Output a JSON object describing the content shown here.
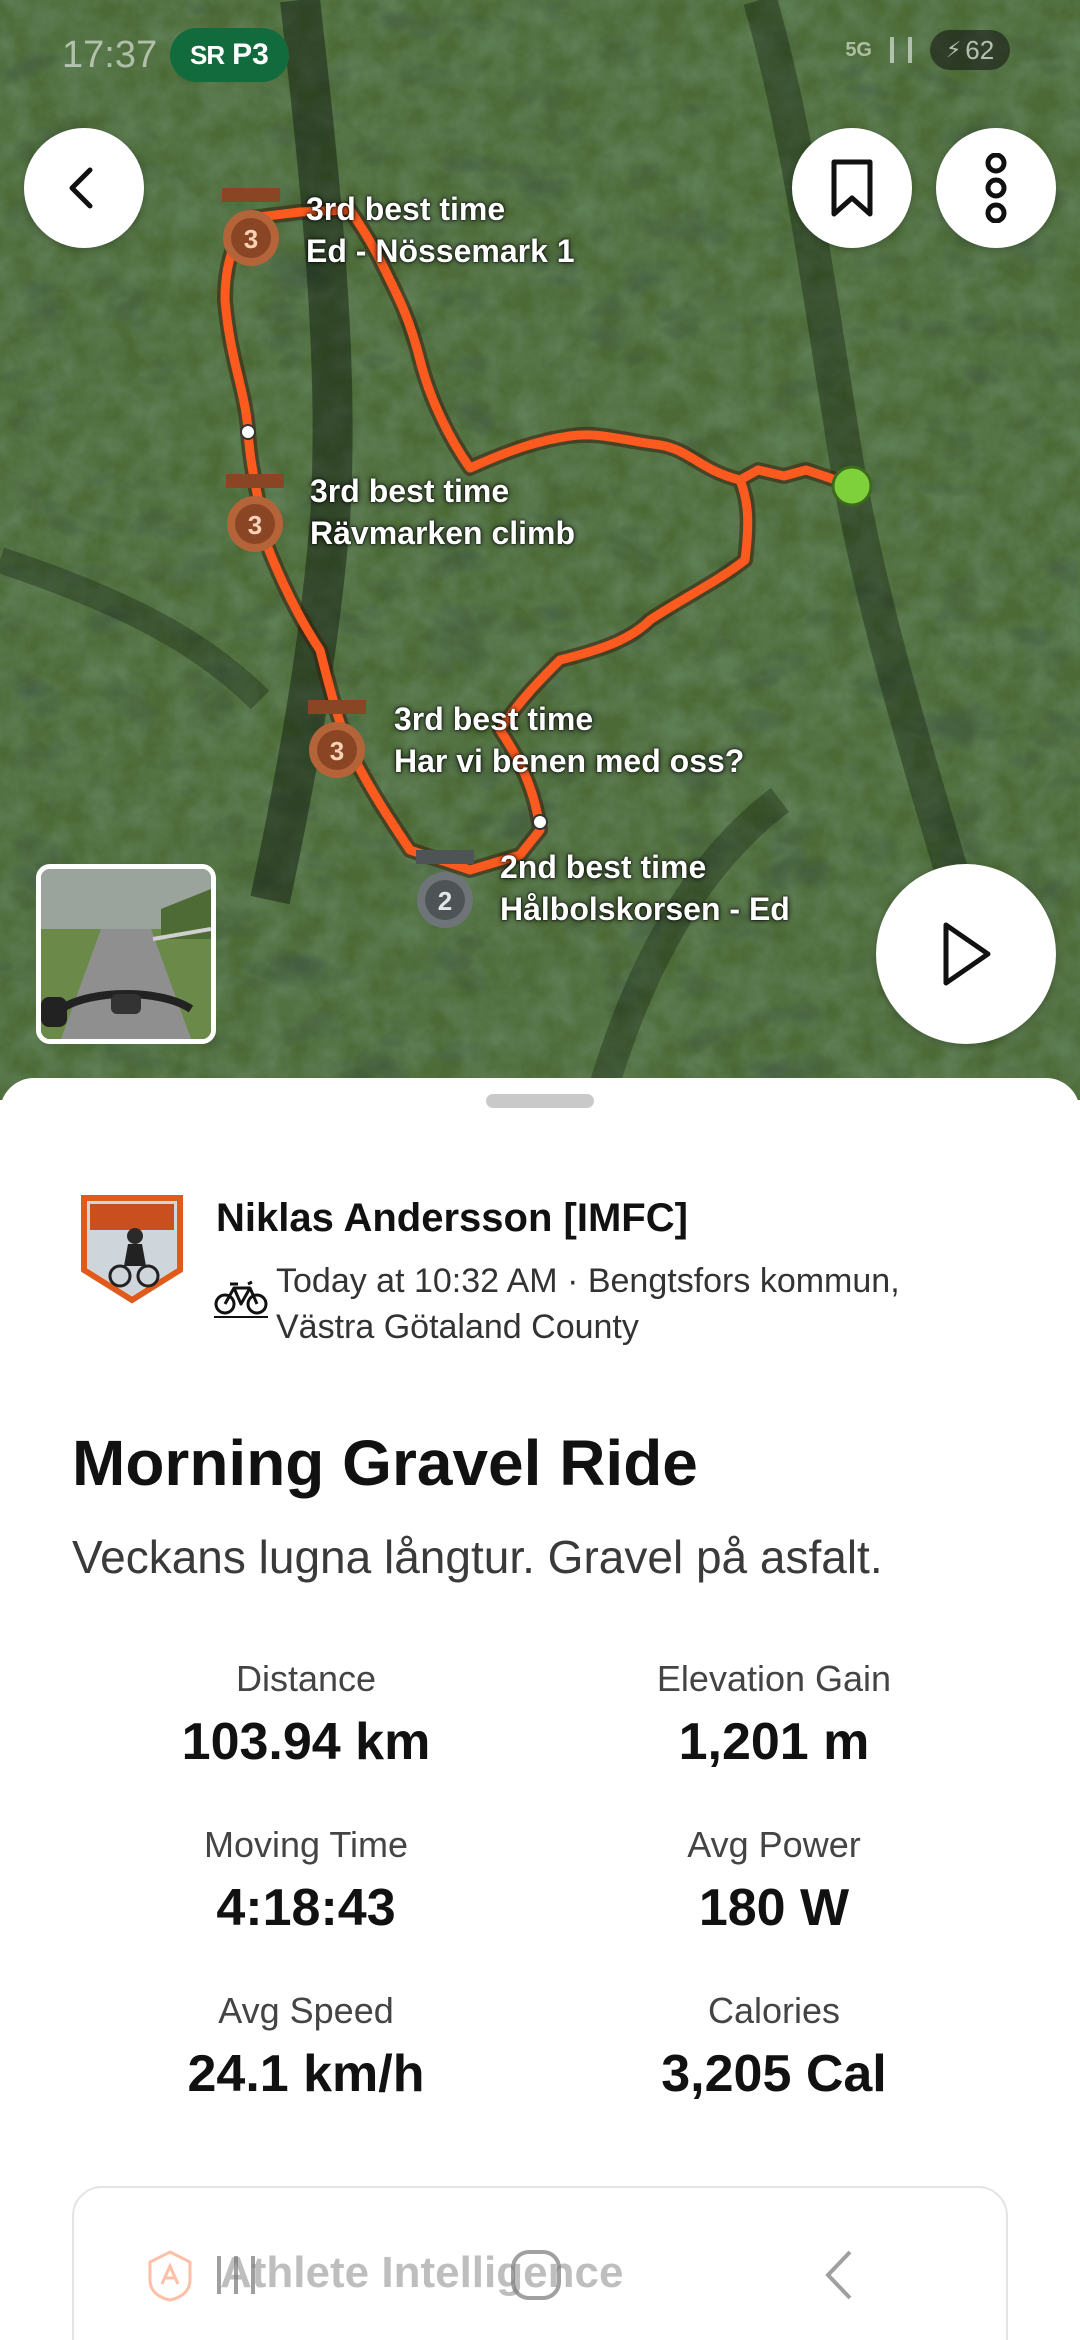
{
  "status_bar": {
    "time": "17:37",
    "radio_badge_logo": "SR",
    "radio_badge_label": "P3",
    "network": "5G",
    "battery": "62"
  },
  "map": {
    "segments": [
      {
        "rank_text": "3rd best time",
        "name": "Ed - Nössemark 1",
        "rank": "3",
        "medal": "bronze"
      },
      {
        "rank_text": "3rd best time",
        "name": "Rävmarken climb",
        "rank": "3",
        "medal": "bronze"
      },
      {
        "rank_text": "3rd best time",
        "name": "Har vi benen med oss?",
        "rank": "3",
        "medal": "bronze"
      },
      {
        "rank_text": "2nd best time",
        "name": "Hålbolskorsen - Ed",
        "rank": "2",
        "medal": "silver"
      }
    ],
    "route_color": "#fc5a1f",
    "start_marker_color": "#7fd13b"
  },
  "activity": {
    "athlete_name": "Niklas Andersson [IMFC]",
    "meta_line1": "Today at 10:32 AM · Bengtsfors kommun,",
    "meta_line2": "Västra Götaland County",
    "activity_type_icon": "bike-icon",
    "title": "Morning Gravel Ride",
    "description": "Veckans lugna långtur. Gravel på asfalt."
  },
  "stats": [
    {
      "label": "Distance",
      "value": "103.94 km"
    },
    {
      "label": "Elevation Gain",
      "value": "1,201 m"
    },
    {
      "label": "Moving Time",
      "value": "4:18:43"
    },
    {
      "label": "Avg Power",
      "value": "180 W"
    },
    {
      "label": "Avg Speed",
      "value": "24.1 km/h"
    },
    {
      "label": "Calories",
      "value": "3,205 Cal"
    }
  ],
  "athlete_intelligence": {
    "label": "Athlete Intelligence"
  },
  "colors": {
    "brand": "#fc4c02",
    "bronze": "#b5643a",
    "silver": "#6f7478"
  }
}
